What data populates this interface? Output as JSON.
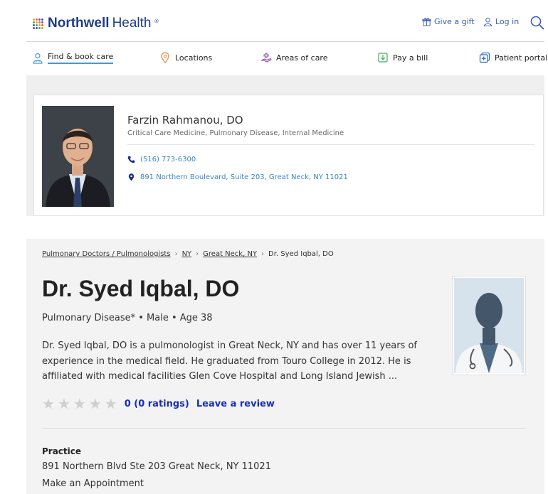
{
  "header": {
    "brand_bold": "Northwell",
    "brand_light": "Health",
    "brand_mark": "®",
    "give_gift": "Give a gift",
    "log_in": "Log in"
  },
  "nav": {
    "items": [
      {
        "label": "Find & book care",
        "icon": "doctor-icon"
      },
      {
        "label": "Locations",
        "icon": "location-pin-icon"
      },
      {
        "label": "Areas of care",
        "icon": "hand-care-icon"
      },
      {
        "label": "Pay a bill",
        "icon": "bill-icon"
      },
      {
        "label": "Patient portal",
        "icon": "portal-icon"
      }
    ]
  },
  "card": {
    "name": "Farzin Rahmanou, DO",
    "specialties": "Critical Care Medicine, Pulmonary Disease, Internal Medicine",
    "phone": "(516) 773-6300",
    "address": "891 Northern Boulevard, Suite 203, Great Neck, NY 11021"
  },
  "profile": {
    "breadcrumbs": [
      "Pulmonary Doctors / Pulmonologists",
      "NY",
      "Great Neck, NY",
      "Dr. Syed Iqbal, DO"
    ],
    "title": "Dr. Syed Iqbal, DO",
    "subtitle": "Pulmonary Disease* • Male • Age 38",
    "bio": "Dr. Syed Iqbal, DO is a pulmonologist in Great Neck, NY and has over 11 years of experience in the medical field. He graduated from Touro College in 2012. He is affiliated with medical facilities Glen Cove Hospital and Long Island Jewish ...",
    "rating_value": "0 (0 ratings)",
    "review_link": "Leave a review",
    "practice_heading": "Practice",
    "practice_address": "891 Northern Blvd Ste 203 Great Neck, NY 11021",
    "appointment": "Make an Appointment"
  },
  "colors": {
    "brand": "#1f3c88",
    "link": "#3a86c8",
    "rating_link": "#1a2fb0"
  }
}
